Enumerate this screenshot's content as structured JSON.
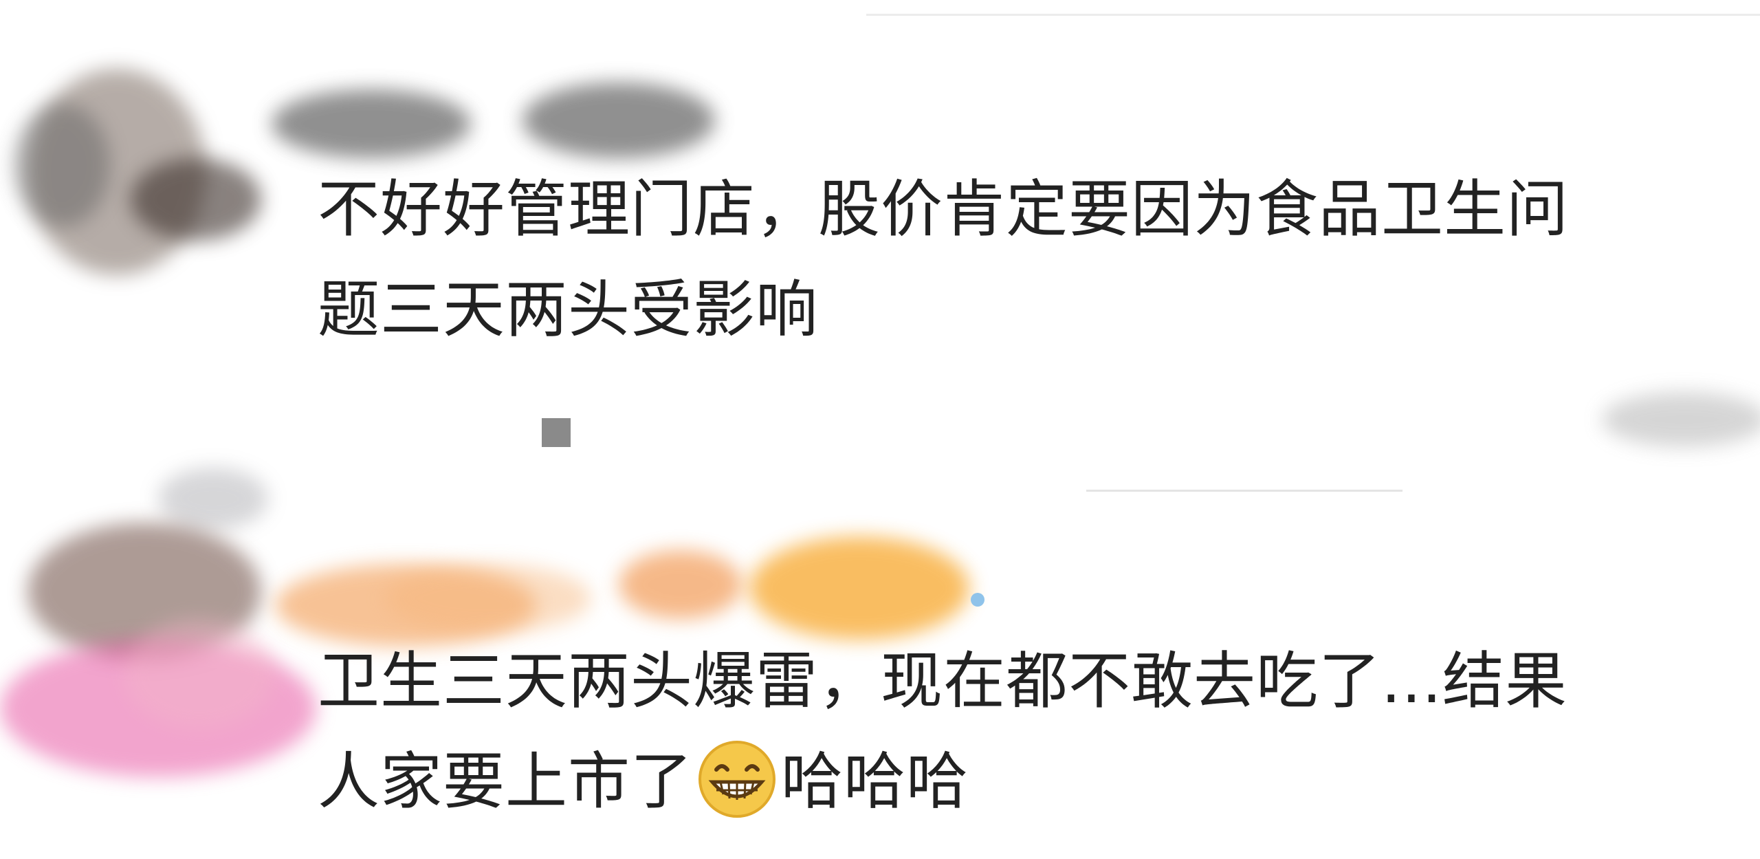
{
  "comments": [
    {
      "lines": [
        "不好好管理门店，股价肯定要因为食品卫生问",
        "题三天两头受影响"
      ]
    },
    {
      "line1": "卫生三天两头爆雷，现在都不敢去吃了...结果",
      "line2_before_emoji": "人家要上市了",
      "emoji": "grinning-face-emoji",
      "line2_after_emoji": "哈哈哈"
    }
  ],
  "colors": {
    "text": "#222222",
    "blur_grey": "#6b6b6b",
    "blur_orange": "#f4a35c",
    "blur_pink": "#e85aa5",
    "emoji_yellow": "#f5c84a"
  }
}
